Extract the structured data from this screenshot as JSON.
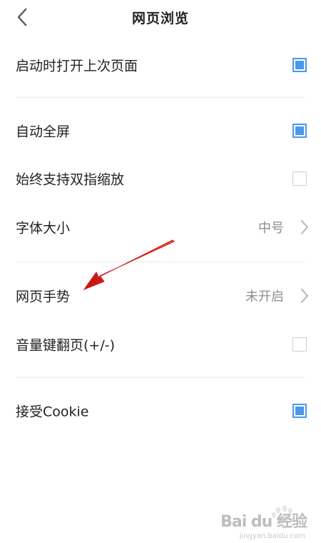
{
  "header": {
    "title": "网页浏览",
    "back_icon": "chevron-left-icon"
  },
  "settings": [
    {
      "label": "启动时打开上次页面",
      "type": "checkbox",
      "checked": true
    },
    {
      "label": "自动全屏",
      "type": "checkbox",
      "checked": true
    },
    {
      "label": "始终支持双指缩放",
      "type": "checkbox",
      "checked": false
    },
    {
      "label": "字体大小",
      "type": "select",
      "value": "中号"
    },
    {
      "label": "网页手势",
      "type": "select",
      "value": "未开启"
    },
    {
      "label": "音量键翻页(+/-)",
      "type": "checkbox",
      "checked": false
    },
    {
      "label": "接受Cookie",
      "type": "checkbox",
      "checked": true
    }
  ],
  "watermark": {
    "brand": "Bai du 经验",
    "site": "jingyan.baidu.com"
  },
  "colors": {
    "accent": "#4a97ec",
    "annotation_arrow": "#e02020"
  }
}
